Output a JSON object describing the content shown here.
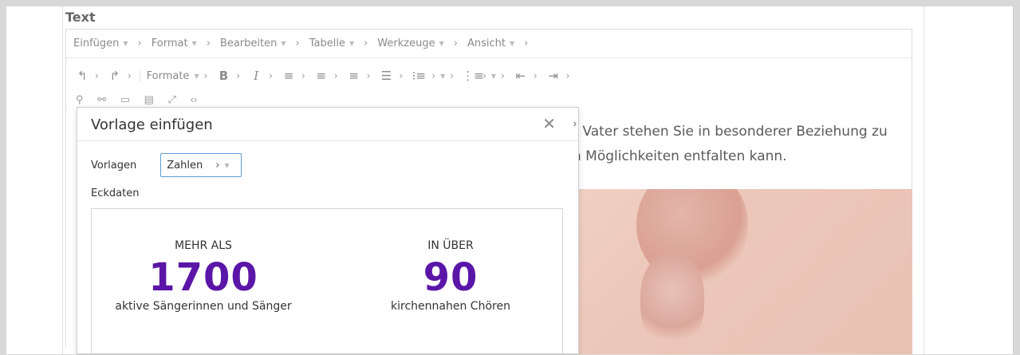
{
  "field_label": "Text",
  "menubar": {
    "items": [
      "Einfügen",
      "Format",
      "Bearbeiten",
      "Tabelle",
      "Werkzeuge",
      "Ansicht"
    ]
  },
  "toolbar": {
    "formats_label": "Formate"
  },
  "content": {
    "line1": "r Vater stehen Sie in besonderer Beziehung zu",
    "line2": "n Möglichkeiten entfalten kann."
  },
  "dialog": {
    "title": "Vorlage einfügen",
    "templates_label": "Vorlagen",
    "templates_value": "Zahlen",
    "key_data_label": "Eckdaten"
  },
  "preview": {
    "stat1": {
      "prefix": "MEHR ALS",
      "number": "1700",
      "suffix": "aktive Sängerinnen und Sänger"
    },
    "stat2": {
      "prefix": "IN ÜBER",
      "number": "90",
      "suffix": "kirchennahen Chören"
    }
  },
  "colors": {
    "accent_number": "#5b16a8",
    "select_border": "#5b9bd5"
  }
}
